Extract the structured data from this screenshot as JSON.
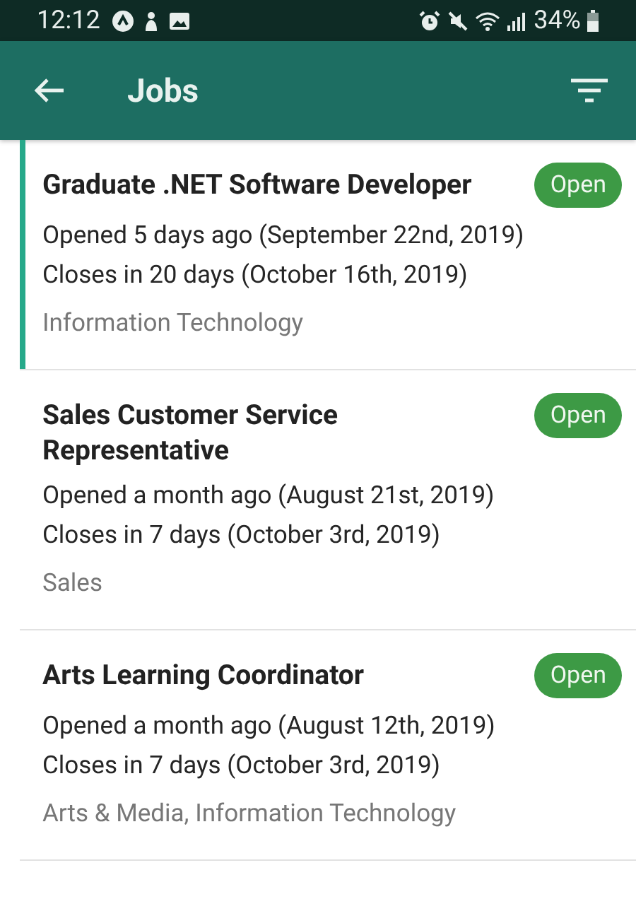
{
  "status_bar": {
    "time": "12:12",
    "battery": "34%"
  },
  "app_bar": {
    "title": "Jobs"
  },
  "jobs": [
    {
      "title": "Graduate .NET Software Developer",
      "status": "Open",
      "opened": "Opened 5 days ago (September 22nd, 2019)",
      "closes": "Closes in 20 days (October 16th, 2019)",
      "category": "Information Technology",
      "selected": true
    },
    {
      "title": "Sales Customer Service Representative",
      "status": "Open",
      "opened": "Opened a month ago (August 21st, 2019)",
      "closes": "Closes in 7 days (October 3rd, 2019)",
      "category": "Sales",
      "selected": false
    },
    {
      "title": "Arts Learning Coordinator",
      "status": "Open",
      "opened": "Opened a month ago (August 12th, 2019)",
      "closes": "Closes in 7 days (October 3rd, 2019)",
      "category": "Arts & Media, Information Technology",
      "selected": false
    }
  ]
}
